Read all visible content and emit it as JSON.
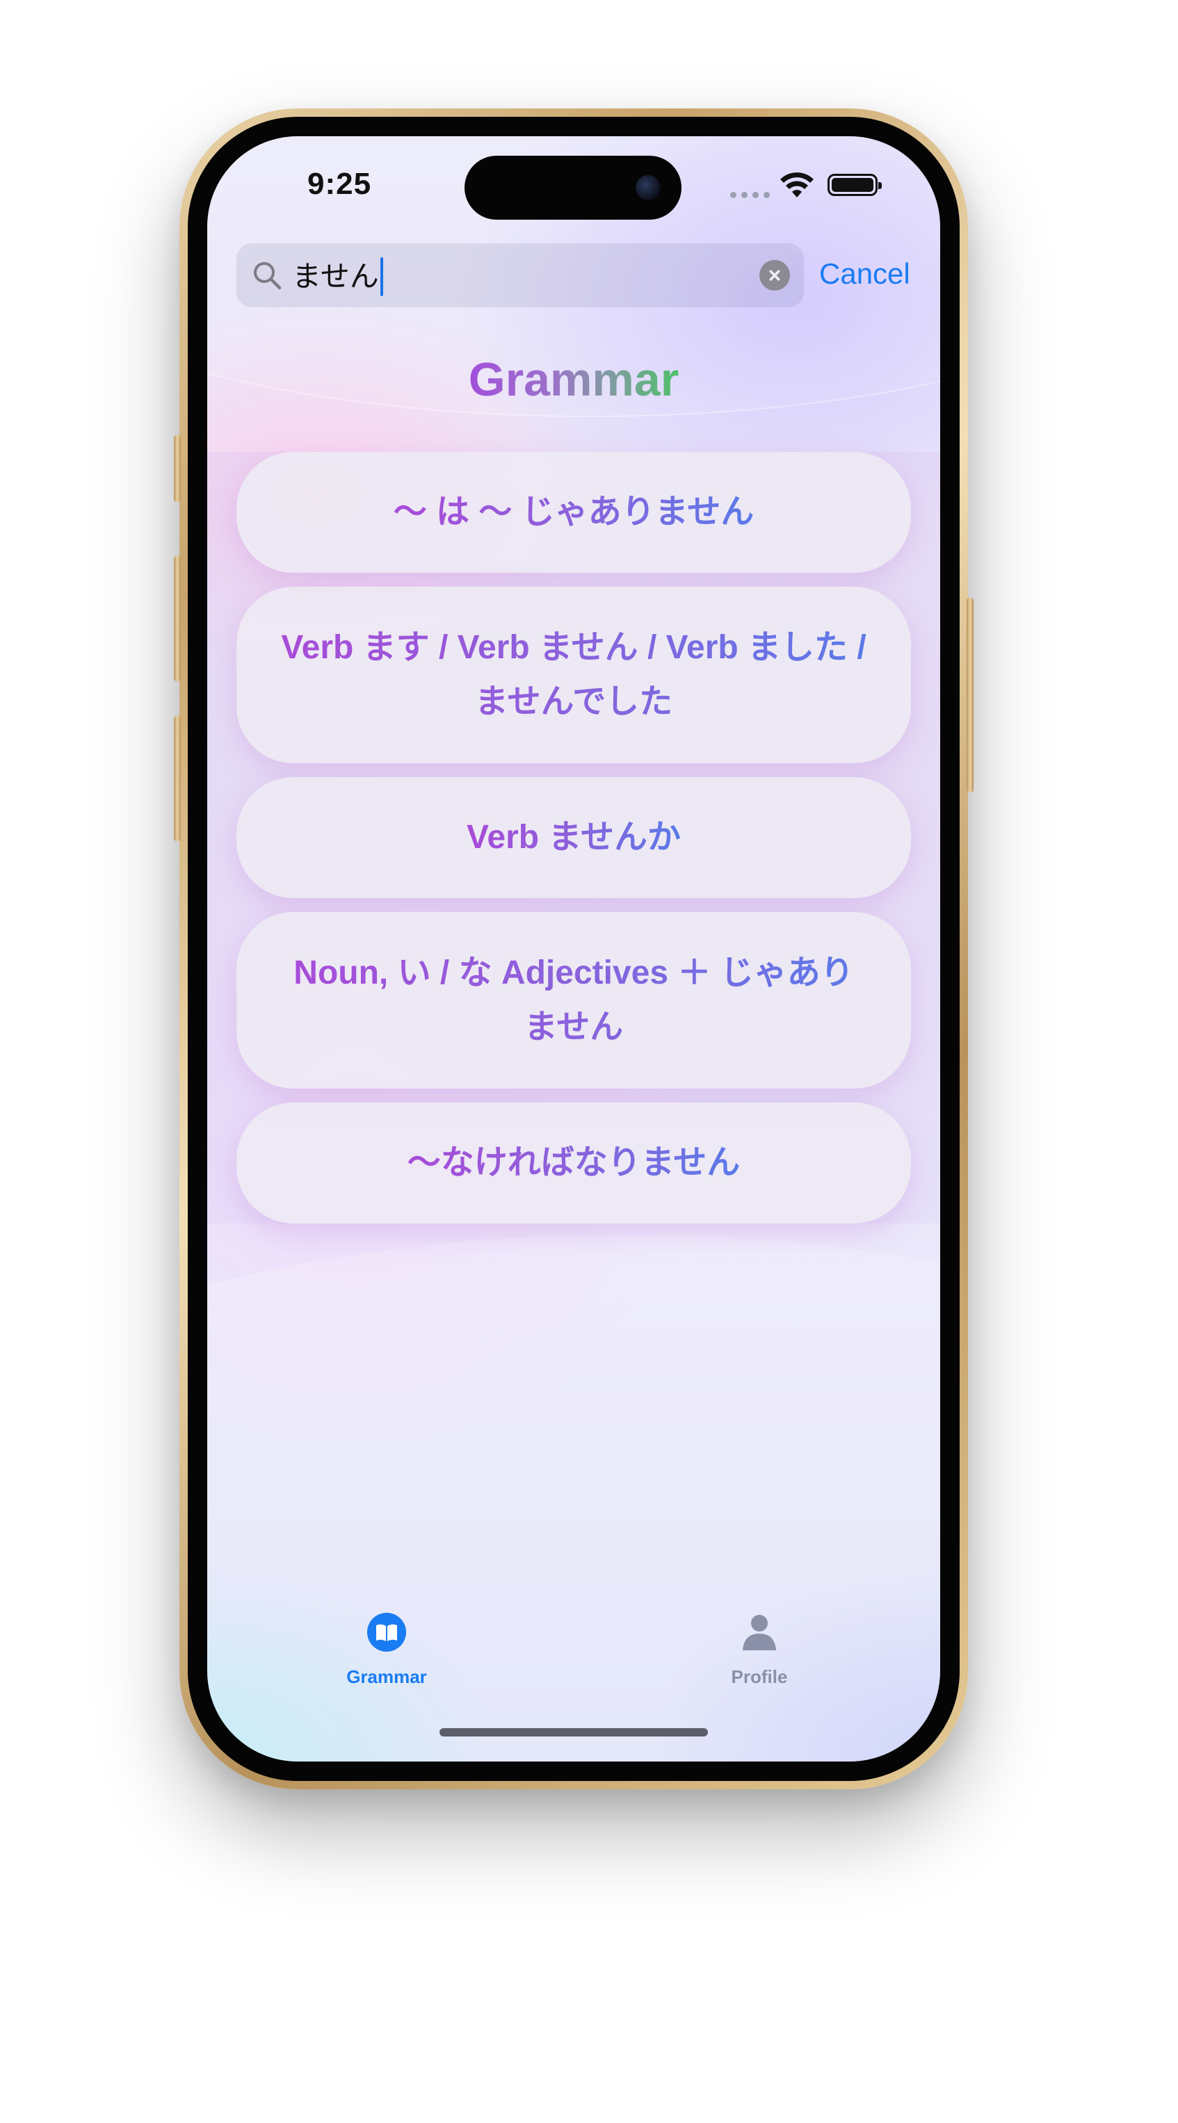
{
  "status_bar": {
    "time": "9:25"
  },
  "search": {
    "query": "ません",
    "clear_icon": "xmark-circle-icon",
    "cancel_label": "Cancel"
  },
  "page": {
    "title": "Grammar"
  },
  "results": [
    {
      "label": "〜 は 〜 じゃありません"
    },
    {
      "label": "Verb ます / Verb ません / Verb ました / ませんでした"
    },
    {
      "label": "Verb ませんか"
    },
    {
      "label": "Noun, い / な Adjectives ＋ じゃありません"
    },
    {
      "label": "〜なければなりません"
    }
  ],
  "tab_bar": {
    "tabs": [
      {
        "label": "Grammar",
        "icon": "book-icon",
        "selected": true
      },
      {
        "label": "Profile",
        "icon": "person-icon",
        "selected": false
      }
    ]
  },
  "colors": {
    "accent": "#1a7cf2",
    "title_gradient": [
      "#a24fdb",
      "#4fc06a"
    ],
    "card_text_gradient": [
      "#a94bd8",
      "#5b7ae8"
    ],
    "tab_inactive": "#8a90a8"
  }
}
